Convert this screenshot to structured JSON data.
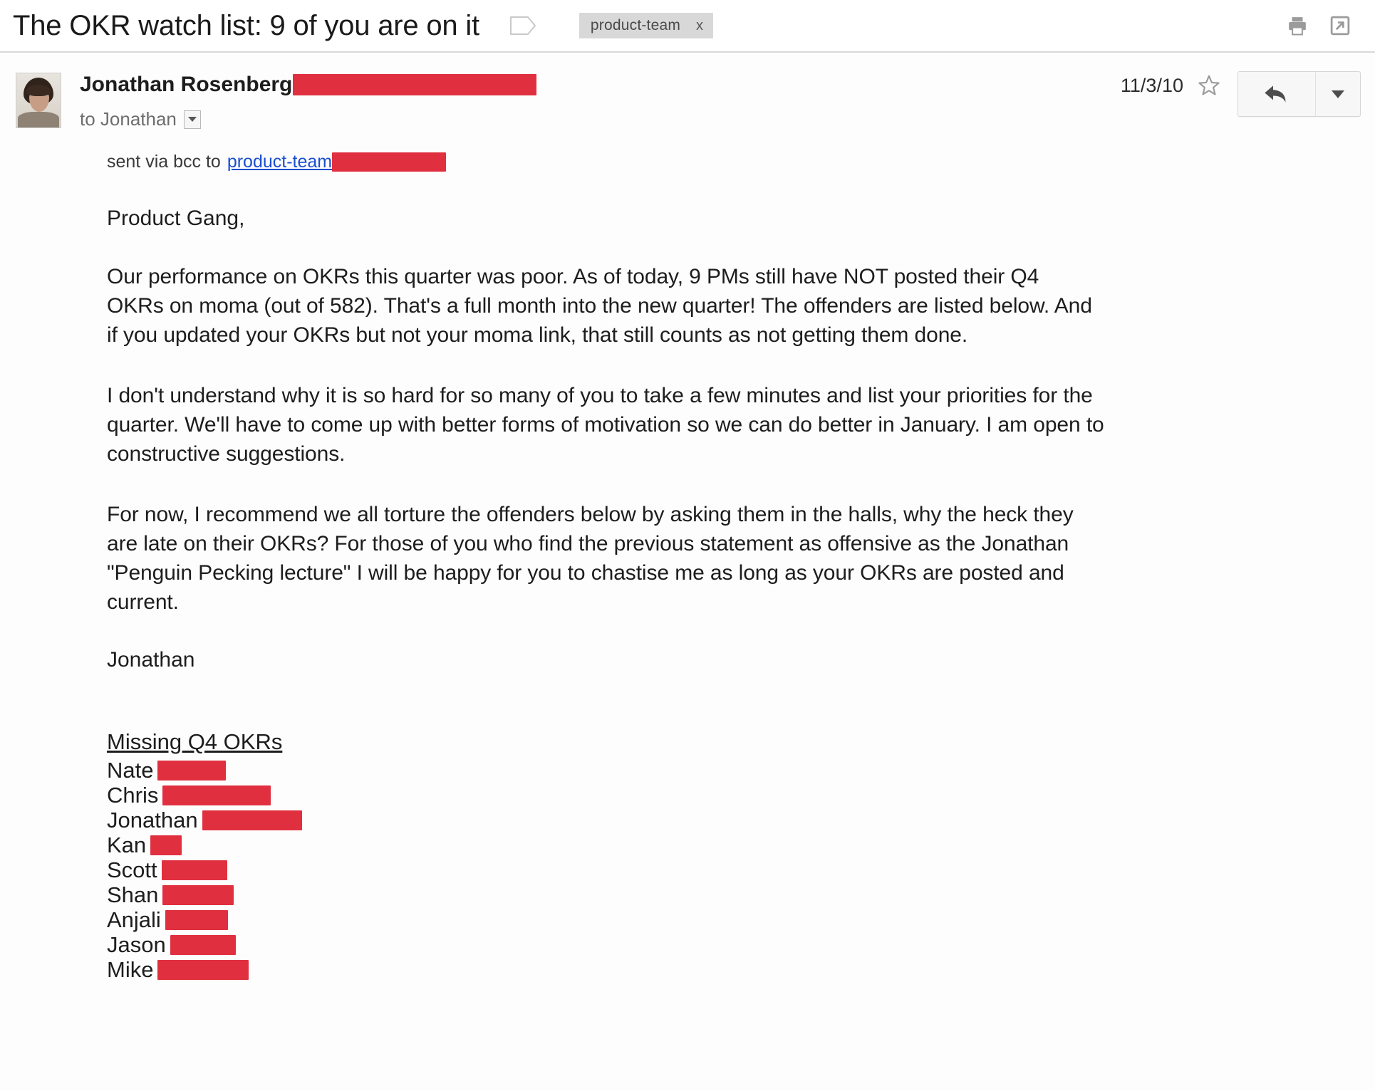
{
  "subject": {
    "text": "The OKR watch list: 9 of you are on it",
    "inbox_tag_icon": "label-tag-icon",
    "label_chip": "product-team",
    "label_chip_remove": "x",
    "print_icon": "printer-icon",
    "popout_icon": "open-in-new-window-icon"
  },
  "message_header": {
    "avatar": "sender-avatar-photo",
    "from_name": "Jonathan Rosenberg",
    "from_email_redacted": true,
    "to_line": "to Jonathan",
    "to_caret_icon": "chevron-down-icon",
    "date": "11/3/10",
    "star_icon": "star-icon",
    "reply_icon": "reply-arrow-icon",
    "reply_more_icon": "chevron-down-icon"
  },
  "body": {
    "bcc_prefix": "sent via bcc to",
    "bcc_link": "product-team",
    "greeting": "Product Gang,",
    "paragraph_1": "Our performance on OKRs this quarter was poor.  As of today, 9 PMs still have NOT posted their Q4 OKRs on moma (out of 582).  That's a full month into the new quarter!  The offenders are listed below.  And if you updated your OKRs but not your moma link, that still counts as not getting them done.",
    "paragraph_2": "I don't understand why it is so hard for so many of you to take a few minutes and list your priorities for the quarter.   We'll have to come up with better forms of motivation so we can do better in January. I am open to constructive suggestions.",
    "paragraph_3": "For now, I recommend we all torture the offenders below by asking them in the halls, why the heck they are late on their OKRs? For those of you who find the previous statement as offensive as the Jonathan \"Penguin Pecking lecture\" I will be happy for you to chastise me as long as your OKRs are posted and current.",
    "signature": "Jonathan",
    "list_heading": "Missing Q4 OKRs",
    "offenders": [
      {
        "first_name": "Nate",
        "redaction_width": 96
      },
      {
        "first_name": "Chris",
        "redaction_width": 152
      },
      {
        "first_name": "Jonathan",
        "redaction_width": 140
      },
      {
        "first_name": "Kan",
        "redaction_width": 44
      },
      {
        "first_name": "Scott",
        "redaction_width": 92
      },
      {
        "first_name": "Shan",
        "redaction_width": 100
      },
      {
        "first_name": "Anjali",
        "redaction_width": 88
      },
      {
        "first_name": "Jason",
        "redaction_width": 92
      },
      {
        "first_name": "Mike",
        "redaction_width": 128
      }
    ]
  },
  "colors": {
    "redaction_red": "#e03040",
    "link_blue": "#1a4fd0",
    "label_chip_bg": "#d8d8d8",
    "text": "#1d1d1d",
    "muted_text": "#6d6d6d"
  }
}
